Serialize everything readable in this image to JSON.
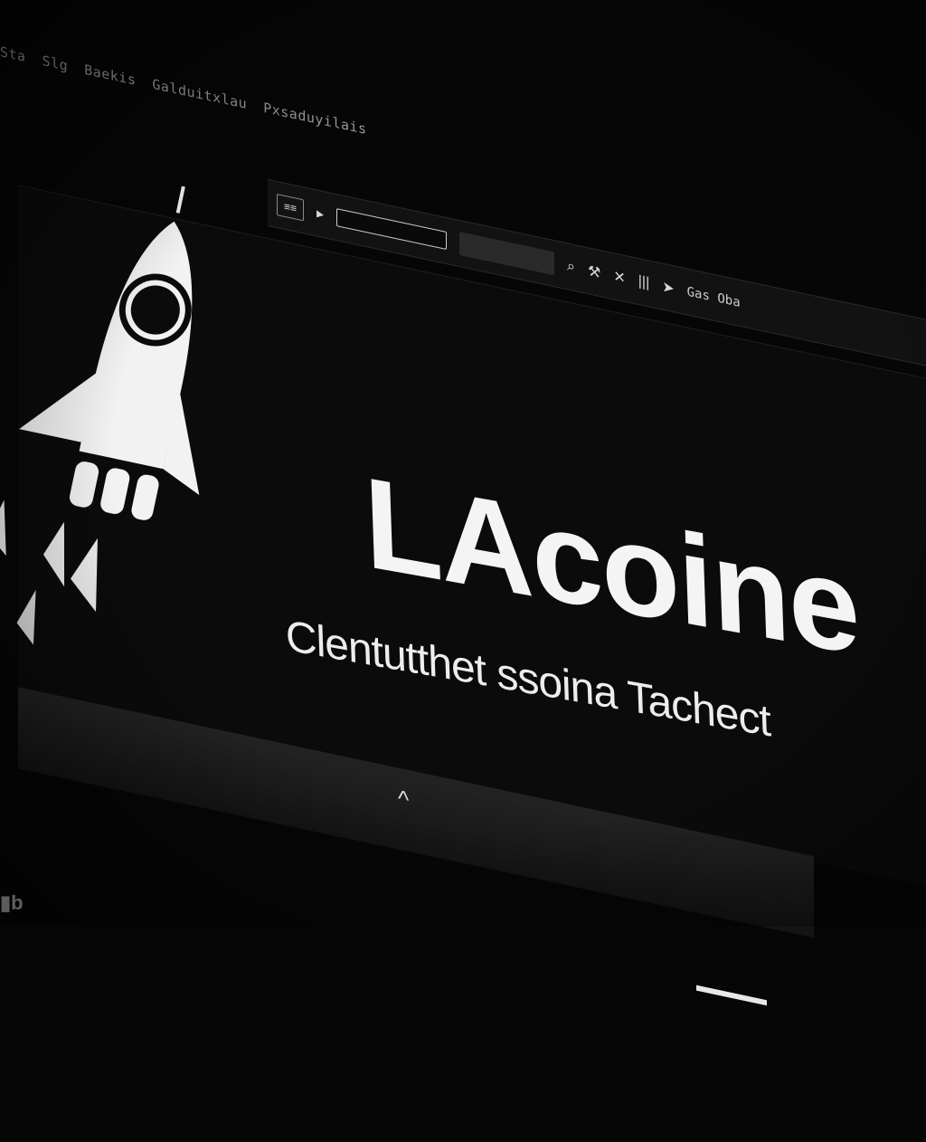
{
  "menu": {
    "items": [
      "Sta",
      "Slg",
      "Baekis",
      "Galduitxlau",
      "Pxsaduyilais"
    ]
  },
  "toolbar": {
    "left_label": "≡≡",
    "icons": [
      "play-icon",
      "zoom-icon",
      "wrench-icon",
      "close-icon",
      "bars-icon",
      "arrow-icon"
    ],
    "right_label": "Gas Oba"
  },
  "hero": {
    "title": "LAcoine",
    "tagline": "Clentutthet ssoina Tachect"
  },
  "footer": {
    "caret": "^"
  },
  "colors": {
    "background": "#060606",
    "panel": "#0b0b0b",
    "text": "#f4f4f4"
  }
}
